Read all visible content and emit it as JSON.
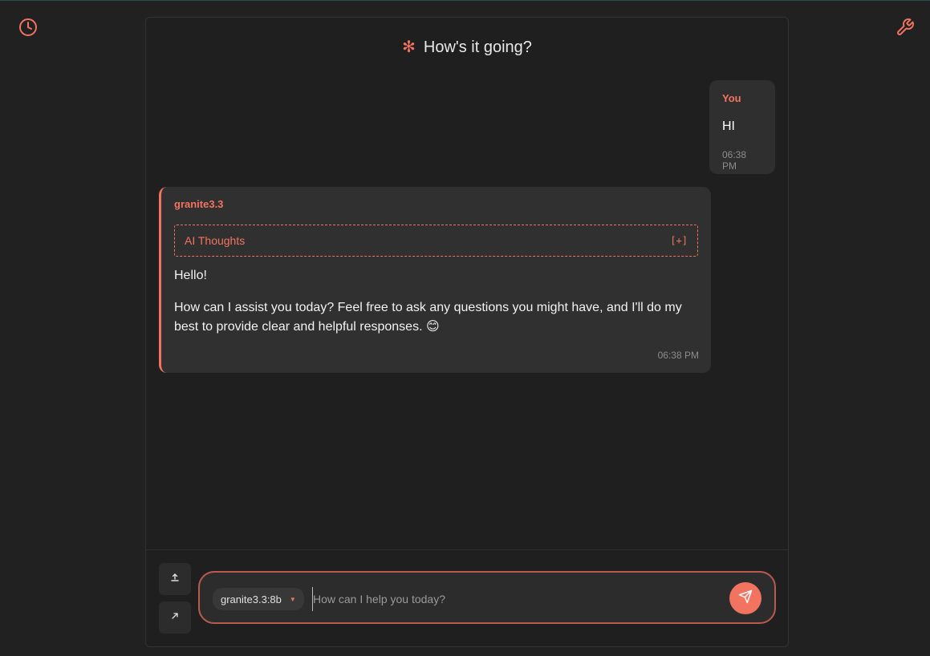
{
  "header": {
    "title": "How's it going?"
  },
  "icons": {
    "history": "clock-icon",
    "tools": "wrench-icon",
    "title": "asterisk-icon",
    "upload": "upload-icon",
    "pin": "arrow-icon",
    "send": "send-icon",
    "model_caret": "caret-down-icon"
  },
  "messages": [
    {
      "sender": "You",
      "text": "HI",
      "time": "06:38 PM"
    },
    {
      "sender": "granite3.3",
      "thoughts_label": "AI Thoughts",
      "thoughts_toggle": "[+]",
      "paragraphs": [
        "Hello!",
        "How can I assist you today? Feel free to ask any questions you might have, and I'll do my best to provide clear and helpful responses. 😊"
      ],
      "time": "06:38 PM"
    }
  ],
  "composer": {
    "model": "granite3.3:8b",
    "placeholder": "How can I help you today?",
    "value": ""
  },
  "colors": {
    "accent": "#f27360",
    "background": "#212121",
    "panel": "#1f1f1f",
    "bubble": "#303030"
  }
}
